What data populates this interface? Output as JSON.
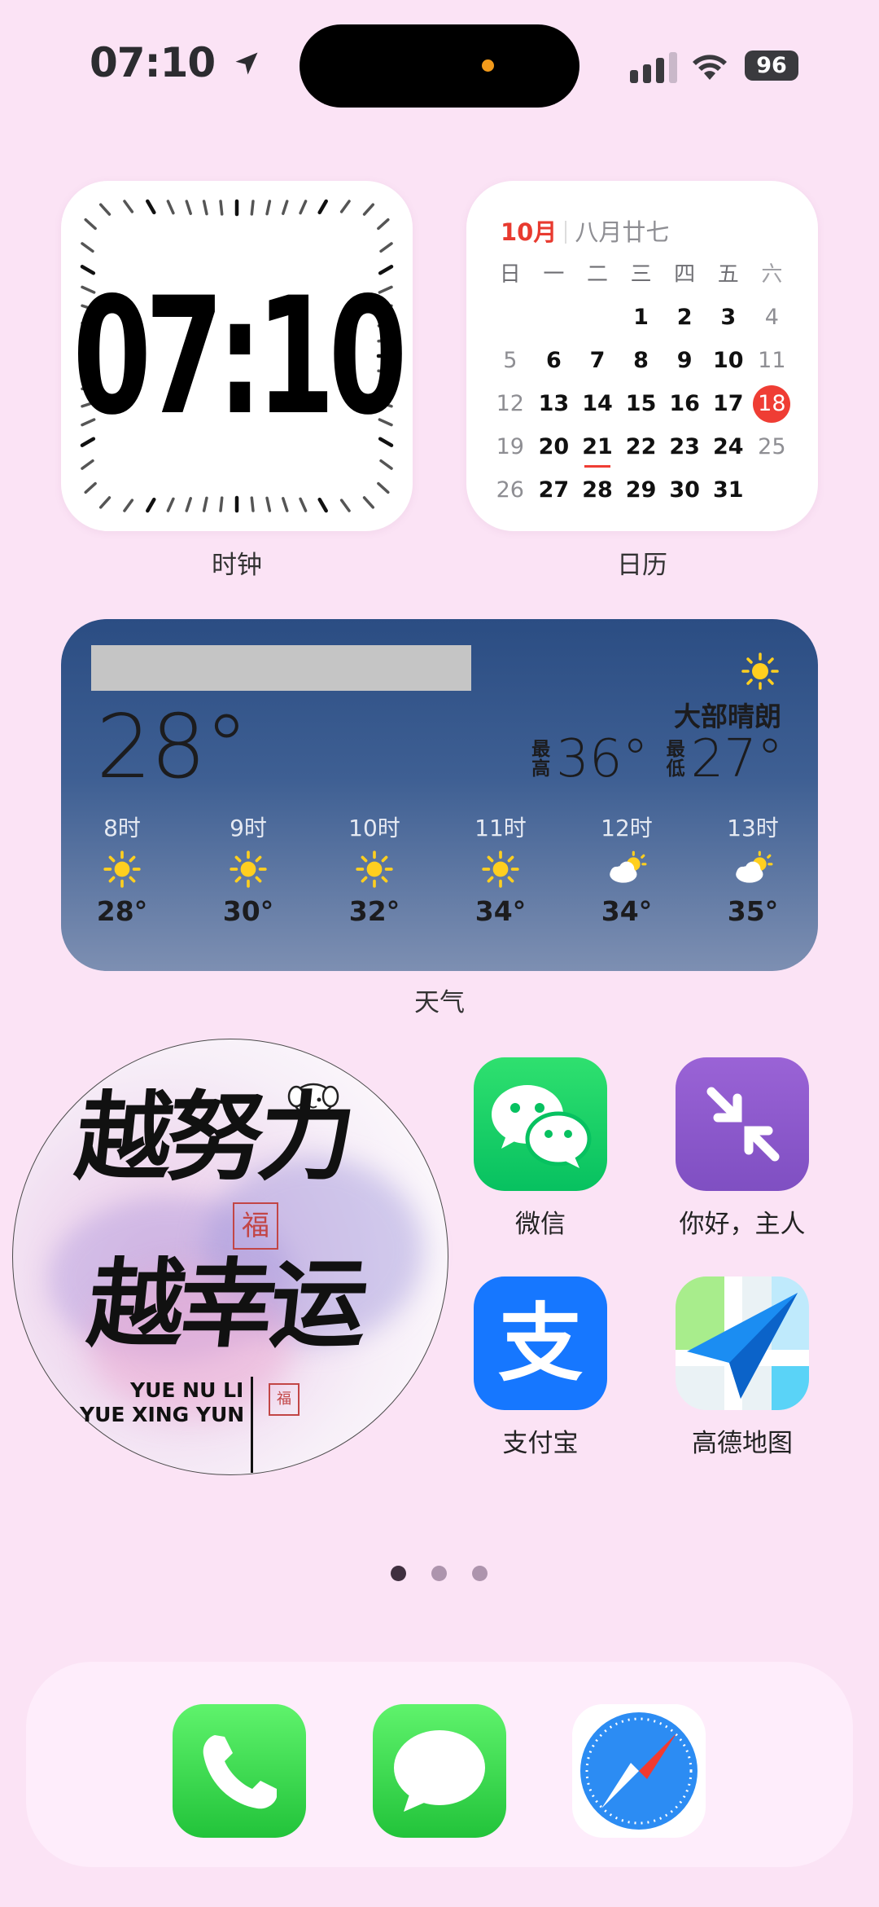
{
  "status_bar": {
    "time": "07:10",
    "battery": "96"
  },
  "widgets": {
    "clock": {
      "time": "07:10",
      "label": "时钟"
    },
    "calendar": {
      "month": "10月",
      "lunar": "八月廿七",
      "label": "日历",
      "weekdays": [
        "日",
        "一",
        "二",
        "三",
        "四",
        "五",
        "六"
      ],
      "weeks": [
        [
          "",
          "",
          "",
          "1",
          "2",
          "3",
          "4"
        ],
        [
          "5",
          "6",
          "7",
          "8",
          "9",
          "10",
          "11"
        ],
        [
          "12",
          "13",
          "14",
          "15",
          "16",
          "17",
          "18"
        ],
        [
          "19",
          "20",
          "21",
          "22",
          "23",
          "24",
          "25"
        ],
        [
          "26",
          "27",
          "28",
          "29",
          "30",
          "31",
          ""
        ]
      ],
      "today": "18",
      "underlined": "21"
    },
    "weather": {
      "label": "天气",
      "current_temp": "28°",
      "condition": "大部晴朗",
      "high_label": "最高",
      "high": "36°",
      "low_label": "最低",
      "low": "27°",
      "hourly": [
        {
          "hour": "8时",
          "icon": "sun-icon",
          "temp": "28°"
        },
        {
          "hour": "9时",
          "icon": "sun-icon",
          "temp": "30°"
        },
        {
          "hour": "10时",
          "icon": "sun-icon",
          "temp": "32°"
        },
        {
          "hour": "11时",
          "icon": "sun-icon",
          "temp": "34°"
        },
        {
          "hour": "12时",
          "icon": "partly-cloudy-icon",
          "temp": "34°"
        },
        {
          "hour": "13时",
          "icon": "partly-cloudy-icon",
          "temp": "35°"
        }
      ]
    },
    "photo": {
      "line1": "越努力",
      "line2": "越幸运",
      "sub1": "YUE NU LI",
      "sub2": "YUE XING YUN",
      "seal": "福"
    }
  },
  "apps": [
    {
      "name": "微信",
      "icon": "wechat-icon",
      "color": "#07c160"
    },
    {
      "name": "你好，主人",
      "icon": "compress-arrows-icon",
      "color": "#7f4fc2"
    },
    {
      "name": "支付宝",
      "icon": "alipay-icon",
      "color": "#1677ff"
    },
    {
      "name": "高德地图",
      "icon": "amap-icon",
      "color": "#2f86f7"
    }
  ],
  "page_indicator": {
    "count": 3,
    "active": 1
  },
  "dock": [
    {
      "name": "phone",
      "icon": "phone-icon"
    },
    {
      "name": "messages",
      "icon": "messages-icon"
    },
    {
      "name": "safari",
      "icon": "compass-icon"
    }
  ]
}
